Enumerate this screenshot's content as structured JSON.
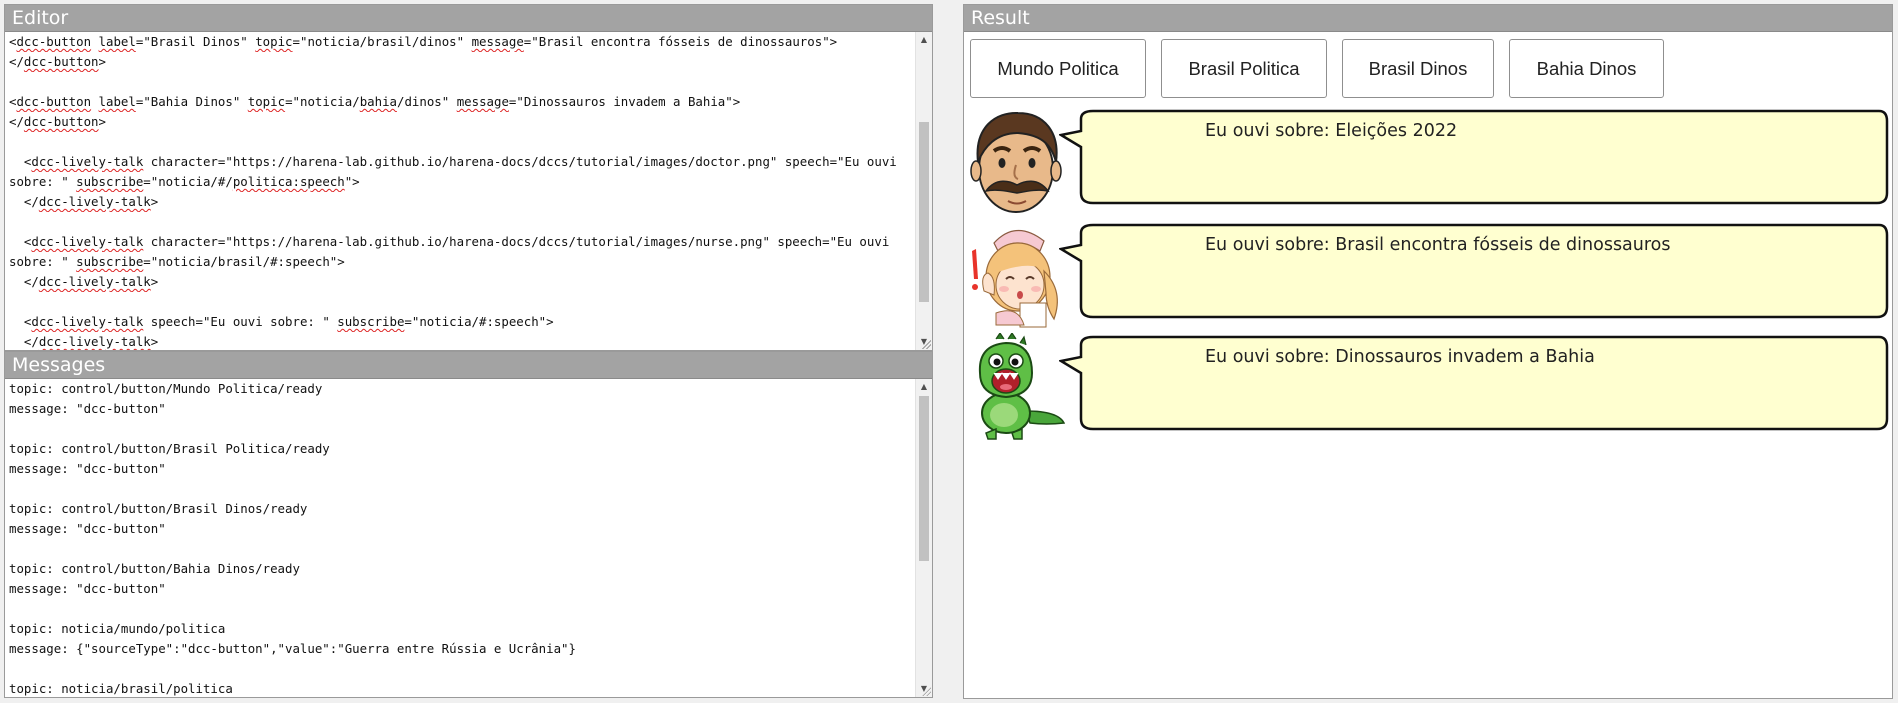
{
  "editor": {
    "title": "Editor",
    "lines": [
      [
        {
          "t": "<"
        },
        {
          "t": "dcc-button",
          "s": 1
        },
        {
          "t": " "
        },
        {
          "t": "label",
          "s": 1
        },
        {
          "t": "=\"Brasil Dinos\" "
        },
        {
          "t": "topic",
          "s": 1
        },
        {
          "t": "=\"noticia/brasil/dinos\" "
        },
        {
          "t": "message",
          "s": 1
        },
        {
          "t": "=\"Brasil encontra fósseis de dinossauros\">"
        }
      ],
      [
        {
          "t": "</"
        },
        {
          "t": "dcc-button",
          "s": 1
        },
        {
          "t": ">"
        }
      ],
      [],
      [
        {
          "t": "<"
        },
        {
          "t": "dcc-button",
          "s": 1
        },
        {
          "t": " "
        },
        {
          "t": "label",
          "s": 1
        },
        {
          "t": "=\"Bahia Dinos\" "
        },
        {
          "t": "topic",
          "s": 1
        },
        {
          "t": "=\"noticia/"
        },
        {
          "t": "bahia",
          "s": 1
        },
        {
          "t": "/dinos\" "
        },
        {
          "t": "message",
          "s": 1
        },
        {
          "t": "=\"Dinossauros invadem a Bahia\">"
        }
      ],
      [
        {
          "t": "</"
        },
        {
          "t": "dcc-button",
          "s": 1
        },
        {
          "t": ">"
        }
      ],
      [],
      [
        {
          "t": "  <"
        },
        {
          "t": "dcc-lively-talk",
          "s": 1
        },
        {
          "t": " character=\"https://harena-lab.github.io/harena-docs/dccs/tutorial/images/doctor.png\" speech=\"Eu ouvi"
        }
      ],
      [
        {
          "t": "sobre: \" "
        },
        {
          "t": "subscribe",
          "s": 1
        },
        {
          "t": "=\"noticia/#/"
        },
        {
          "t": "politica:speech",
          "s": 1
        },
        {
          "t": "\">"
        }
      ],
      [
        {
          "t": "  </"
        },
        {
          "t": "dcc-lively-talk",
          "s": 1
        },
        {
          "t": ">"
        }
      ],
      [],
      [
        {
          "t": "  <"
        },
        {
          "t": "dcc-lively-talk",
          "s": 1
        },
        {
          "t": " character=\"https://harena-lab.github.io/harena-docs/dccs/tutorial/images/nurse.png\" speech=\"Eu ouvi"
        }
      ],
      [
        {
          "t": "sobre: \" "
        },
        {
          "t": "subscribe",
          "s": 1
        },
        {
          "t": "=\"noticia/brasil/#:speech\">"
        }
      ],
      [
        {
          "t": "  </"
        },
        {
          "t": "dcc-lively-talk",
          "s": 1
        },
        {
          "t": ">"
        }
      ],
      [],
      [
        {
          "t": "  <"
        },
        {
          "t": "dcc-lively-talk",
          "s": 1
        },
        {
          "t": " speech=\"Eu ouvi sobre: \" "
        },
        {
          "t": "subscribe",
          "s": 1
        },
        {
          "t": "=\"noticia/#:speech\">"
        }
      ],
      [
        {
          "t": "  </"
        },
        {
          "t": "dcc-lively-talk",
          "s": 1
        },
        {
          "t": ">"
        }
      ]
    ]
  },
  "messages": {
    "title": "Messages",
    "lines": [
      "topic: control/button/Mundo Politica/ready",
      "message: \"dcc-button\"",
      "",
      "topic: control/button/Brasil Politica/ready",
      "message: \"dcc-button\"",
      "",
      "topic: control/button/Brasil Dinos/ready",
      "message: \"dcc-button\"",
      "",
      "topic: control/button/Bahia Dinos/ready",
      "message: \"dcc-button\"",
      "",
      "topic: noticia/mundo/politica",
      "message: {\"sourceType\":\"dcc-button\",\"value\":\"Guerra entre Rússia e Ucrânia\"}",
      "",
      "topic: noticia/brasil/politica"
    ]
  },
  "result": {
    "title": "Result",
    "buttons": [
      "Mundo Politica",
      "Brasil Politica",
      "Brasil Dinos",
      "Bahia Dinos"
    ],
    "talks": [
      {
        "character": "doctor-avatar",
        "text": "Eu ouvi sobre: Eleições 2022"
      },
      {
        "character": "nurse-avatar",
        "text": "Eu ouvi sobre: Brasil encontra fósseis de dinossauros"
      },
      {
        "character": "dino-avatar",
        "text": "Eu ouvi sobre: Dinossauros invadem a Bahia"
      }
    ]
  },
  "colors": {
    "header_bg": "#a3a3a3",
    "bubble_fill": "#ffffd0",
    "squiggle": "#dd2222"
  }
}
